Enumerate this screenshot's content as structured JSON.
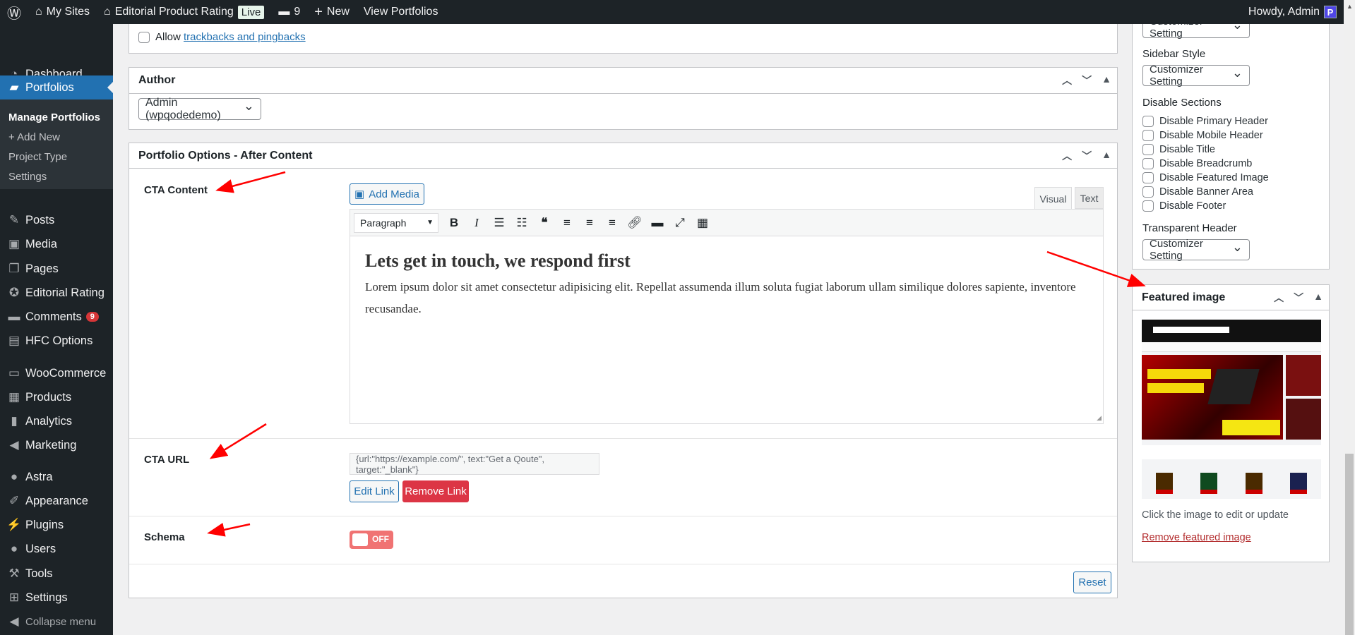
{
  "adminbar": {
    "my_sites": "My Sites",
    "site_name": "Editorial Product Rating",
    "live": "Live",
    "comments_count": "9",
    "new": "New",
    "view": "View Portfolios",
    "howdy": "Howdy, Admin",
    "avatar": "P"
  },
  "sidebar": {
    "items": [
      {
        "label": "Dashboard",
        "icon": "dashboard-icon",
        "glyph": "◔"
      },
      {
        "label": "Portfolios",
        "icon": "briefcase-icon",
        "glyph": "▰",
        "active": true
      },
      {
        "label": "Posts",
        "icon": "pin-icon",
        "glyph": "✎"
      },
      {
        "label": "Media",
        "icon": "media-icon",
        "glyph": "▣"
      },
      {
        "label": "Pages",
        "icon": "pages-icon",
        "glyph": "❐"
      },
      {
        "label": "Editorial Rating",
        "icon": "award-icon",
        "glyph": "✪"
      },
      {
        "label": "Comments",
        "icon": "comment-icon",
        "glyph": "▬",
        "badge": "9"
      },
      {
        "label": "HFC Options",
        "icon": "layout-icon",
        "glyph": "▤"
      },
      {
        "label": "WooCommerce",
        "icon": "woo-icon",
        "glyph": "▭"
      },
      {
        "label": "Products",
        "icon": "archive-icon",
        "glyph": "▦"
      },
      {
        "label": "Analytics",
        "icon": "chart-icon",
        "glyph": "▮"
      },
      {
        "label": "Marketing",
        "icon": "megaphone-icon",
        "glyph": "◀"
      },
      {
        "label": "Astra",
        "icon": "astra-icon",
        "glyph": "●"
      },
      {
        "label": "Appearance",
        "icon": "brush-icon",
        "glyph": "✐"
      },
      {
        "label": "Plugins",
        "icon": "plug-icon",
        "glyph": "⚡"
      },
      {
        "label": "Users",
        "icon": "user-icon",
        "glyph": "●"
      },
      {
        "label": "Tools",
        "icon": "wrench-icon",
        "glyph": "⚒"
      },
      {
        "label": "Settings",
        "icon": "sliders-icon",
        "glyph": "⊞"
      },
      {
        "label": "Collapse menu",
        "icon": "collapse-icon",
        "glyph": "◀"
      }
    ],
    "submenu": [
      {
        "label": "Manage Portfolios",
        "current": true
      },
      {
        "label": "+ Add New"
      },
      {
        "label": "Project Type"
      },
      {
        "label": "Settings"
      }
    ]
  },
  "discussion": {
    "trackbacks_prefix": "Allow ",
    "trackbacks_link": "trackbacks and pingbacks"
  },
  "author": {
    "title": "Author",
    "selected": "Admin (wpqodedemo)"
  },
  "options": {
    "title": "Portfolio Options - After Content",
    "cta_content_label": "CTA Content",
    "add_media": "Add Media",
    "tab_visual": "Visual",
    "tab_text": "Text",
    "format": "Paragraph",
    "heading": "Lets get in touch, we respond first",
    "body": "Lorem ipsum dolor sit amet consectetur adipisicing elit. Repellat assumenda illum soluta fugiat laborum ullam similique dolores sapiente, inventore recusandae.",
    "cta_url_label": "CTA URL",
    "cta_url_value": "{url:\"https://example.com/\", text:\"Get a Qoute\", target:\"_blank\"}",
    "edit_link": "Edit Link",
    "remove_link": "Remove Link",
    "schema_label": "Schema",
    "schema_toggle": "OFF",
    "reset": "Reset"
  },
  "settings": {
    "top_select": "Customizer Setting",
    "sidebar_style_label": "Sidebar Style",
    "sidebar_style": "Customizer Setting",
    "disable_label": "Disable Sections",
    "disable": [
      "Disable Primary Header",
      "Disable Mobile Header",
      "Disable Title",
      "Disable Breadcrumb",
      "Disable Featured Image",
      "Disable Banner Area",
      "Disable Footer"
    ],
    "transparent_label": "Transparent Header",
    "transparent": "Customizer Setting"
  },
  "featured": {
    "title": "Featured image",
    "hint": "Click the image to edit or update",
    "remove": "Remove featured image"
  },
  "colors": {
    "accent": "#2271b1",
    "danger": "#dc3545",
    "adminbar": "#1d2327",
    "annotation": "#ff0000"
  }
}
